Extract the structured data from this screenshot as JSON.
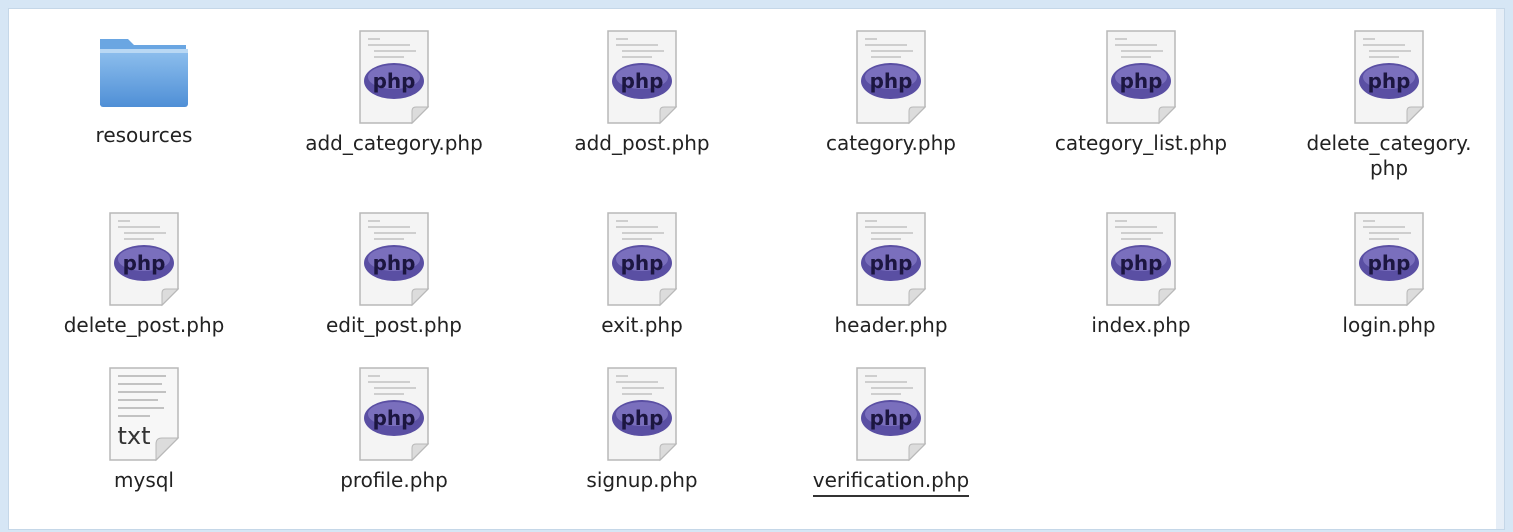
{
  "files": [
    {
      "name": "resources",
      "type": "folder",
      "icon": "folder-icon"
    },
    {
      "name": "add_category.php",
      "type": "php",
      "icon": "php-file-icon"
    },
    {
      "name": "add_post.php",
      "type": "php",
      "icon": "php-file-icon"
    },
    {
      "name": "category.php",
      "type": "php",
      "icon": "php-file-icon"
    },
    {
      "name": "category_list.php",
      "type": "php",
      "icon": "php-file-icon"
    },
    {
      "name": "delete_category.\nphp",
      "type": "php",
      "icon": "php-file-icon"
    },
    {
      "name": "delete_post.php",
      "type": "php",
      "icon": "php-file-icon"
    },
    {
      "name": "edit_post.php",
      "type": "php",
      "icon": "php-file-icon"
    },
    {
      "name": "exit.php",
      "type": "php",
      "icon": "php-file-icon"
    },
    {
      "name": "header.php",
      "type": "php",
      "icon": "php-file-icon"
    },
    {
      "name": "index.php",
      "type": "php",
      "icon": "php-file-icon"
    },
    {
      "name": "login.php",
      "type": "php",
      "icon": "php-file-icon"
    },
    {
      "name": "mysql",
      "type": "txt",
      "icon": "text-file-icon"
    },
    {
      "name": "profile.php",
      "type": "php",
      "icon": "php-file-icon"
    },
    {
      "name": "signup.php",
      "type": "php",
      "icon": "php-file-icon"
    },
    {
      "name": "verification.php",
      "type": "php",
      "icon": "php-file-icon",
      "hovered": true
    }
  ],
  "icon_text": {
    "php": "php",
    "txt": "txt"
  },
  "colors": {
    "folder": "#4f8fd6",
    "php_ellipse": "#5a4fa3",
    "background": "#ffffff"
  }
}
